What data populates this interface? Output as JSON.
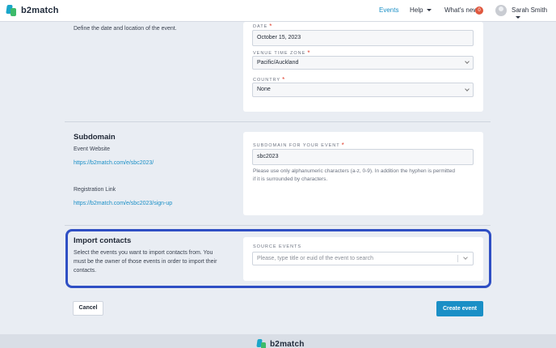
{
  "brand": {
    "name": "b2match"
  },
  "nav": {
    "events": "Events",
    "help": "Help",
    "whats_new": "What's new",
    "whats_new_count": "0",
    "user_name": "Sarah Smith"
  },
  "date_location": {
    "description": "Define the date and location of the event.",
    "date_label": "DATE",
    "date_value": "October 15, 2023",
    "timezone_label": "VENUE TIME ZONE",
    "timezone_value": "Pacific/Auckland",
    "country_label": "COUNTRY",
    "country_value": "None",
    "required_mark": "*"
  },
  "subdomain": {
    "title": "Subdomain",
    "website_label": "Event Website",
    "website_url": "https://b2match.com/e/sbc2023/",
    "registration_label": "Registration Link",
    "registration_url": "https://b2match.com/e/sbc2023/sign-up",
    "field_label": "SUBDOMAIN FOR YOUR EVENT",
    "field_value": "sbc2023",
    "help_line1": "Please use only alphanumeric characters (a-z, 0-9). In addition the hyphen is permitted",
    "help_line2": "if it is surrounded by characters."
  },
  "import_contacts": {
    "title": "Import contacts",
    "desc_line1": "Select the events you want to import contacts from. You",
    "desc_line2": "must be the owner of those events in order to import their",
    "desc_line3": "contacts.",
    "source_label": "SOURCE EVENTS",
    "search_placeholder": "Please, type title or euid of the event to search"
  },
  "actions": {
    "cancel": "Cancel",
    "create": "Create event"
  },
  "colors": {
    "accent": "#1a8fc6",
    "highlight": "#2f4fc4",
    "required": "#e0402f",
    "badge": "#e0583f"
  }
}
